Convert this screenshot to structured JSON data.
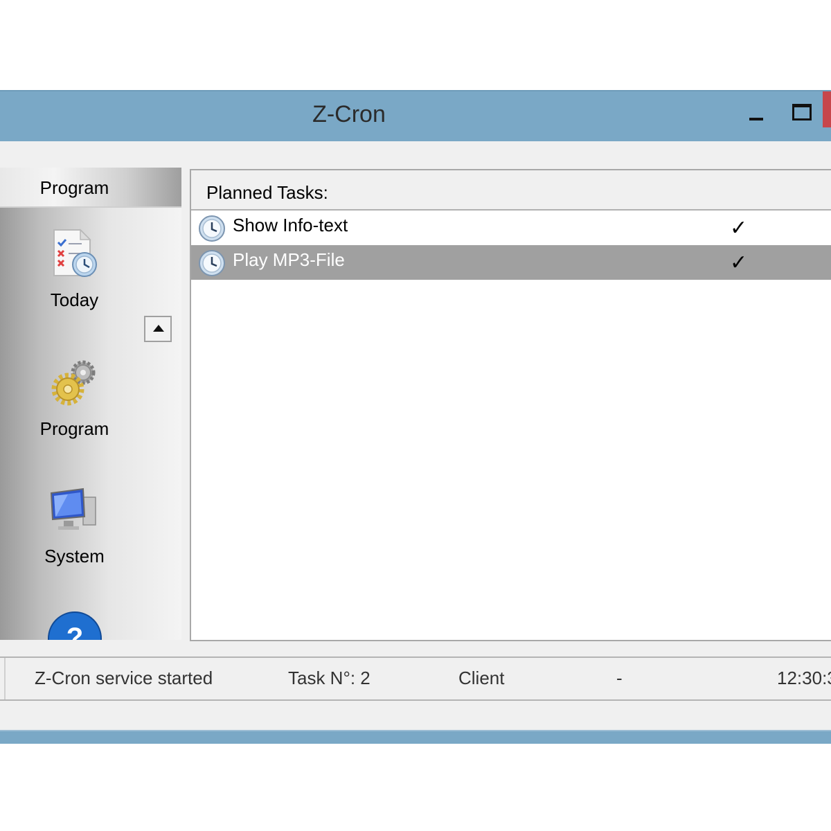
{
  "window": {
    "title": "Z-Cron",
    "accent_color": "#7aa8c6",
    "controls": [
      "minimize-icon",
      "maximize-icon",
      "close-icon"
    ]
  },
  "sidebar": {
    "header": "Program",
    "items": [
      {
        "label": "Today",
        "icon": "today-task-list-icon"
      },
      {
        "label": "Program",
        "icon": "gears-icon"
      },
      {
        "label": "System",
        "icon": "computer-monitor-icon"
      },
      {
        "label": "",
        "icon": "help-icon"
      }
    ],
    "scroll_up_icon": "arrow-up-icon",
    "scroll_down_icon": "arrow-down-icon"
  },
  "tasks": {
    "header": "Planned Tasks:",
    "rows": [
      {
        "name": "Show Info-text",
        "enabled": "✓",
        "icon": "clock-icon",
        "selected": false
      },
      {
        "name": "Play MP3-File",
        "enabled": "✓",
        "icon": "clock-icon",
        "selected": true
      }
    ],
    "selected_color": "#a0a0a0"
  },
  "status": {
    "message": "Z-Cron service started",
    "task_count": "Task N°: 2",
    "mode": "Client",
    "extra": "-",
    "time": "12:30:3"
  }
}
